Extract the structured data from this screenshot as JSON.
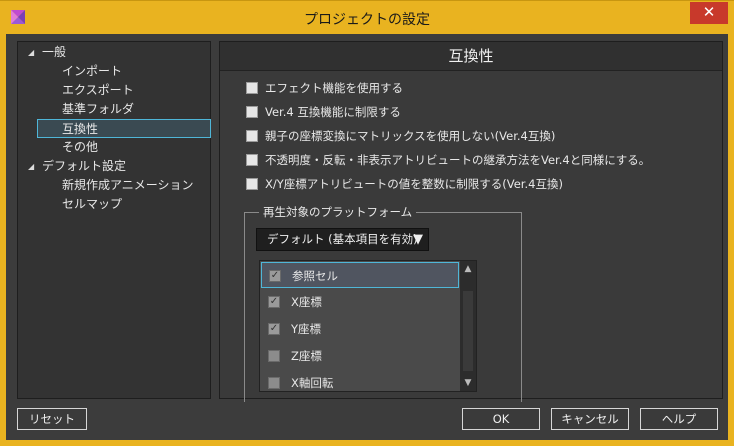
{
  "window": {
    "title": "プロジェクトの設定",
    "close_glyph": "✕"
  },
  "tree": {
    "items": [
      {
        "label": "一般",
        "expanded": true
      },
      {
        "label": "インポート"
      },
      {
        "label": "エクスポート"
      },
      {
        "label": "基準フォルダ"
      },
      {
        "label": "互換性",
        "selected": true
      },
      {
        "label": "その他"
      },
      {
        "label": "デフォルト設定",
        "expanded": true
      },
      {
        "label": "新規作成アニメーション"
      },
      {
        "label": "セルマップ"
      }
    ],
    "toggle_glyph": "◢"
  },
  "panel": {
    "title": "互換性",
    "options": [
      {
        "label": "エフェクト機能を使用する",
        "checked": false
      },
      {
        "label": "Ver.4 互換機能に制限する",
        "checked": false
      },
      {
        "label": "親子の座標変換にマトリックスを使用しない(Ver.4互換)",
        "checked": false
      },
      {
        "label": "不透明度・反転・非表示アトリビュートの継承方法をVer.4と同様にする。",
        "checked": false
      },
      {
        "label": "X/Y座標アトリビュートの値を整数に制限する(Ver.4互換)",
        "checked": false
      }
    ],
    "platform_group": {
      "title": "再生対象のプラットフォーム",
      "dropdown_value": "デフォルト (基本項目を有効)",
      "dropdown_arrow": "▼",
      "attributes": [
        {
          "label": "参照セル",
          "checked": true
        },
        {
          "label": "X座標",
          "checked": true
        },
        {
          "label": "Y座標",
          "checked": true
        },
        {
          "label": "Z座標",
          "checked": false
        },
        {
          "label": "X軸回転",
          "checked": false
        }
      ],
      "scroll_up": "▲",
      "scroll_down": "▼"
    }
  },
  "buttons": {
    "reset": "リセット",
    "ok": "OK",
    "cancel": "キャンセル",
    "help": "ヘルプ"
  },
  "colors": {
    "titlebar": "#e9b320",
    "selection_border": "#4fb6d8",
    "close": "#c8392b"
  }
}
